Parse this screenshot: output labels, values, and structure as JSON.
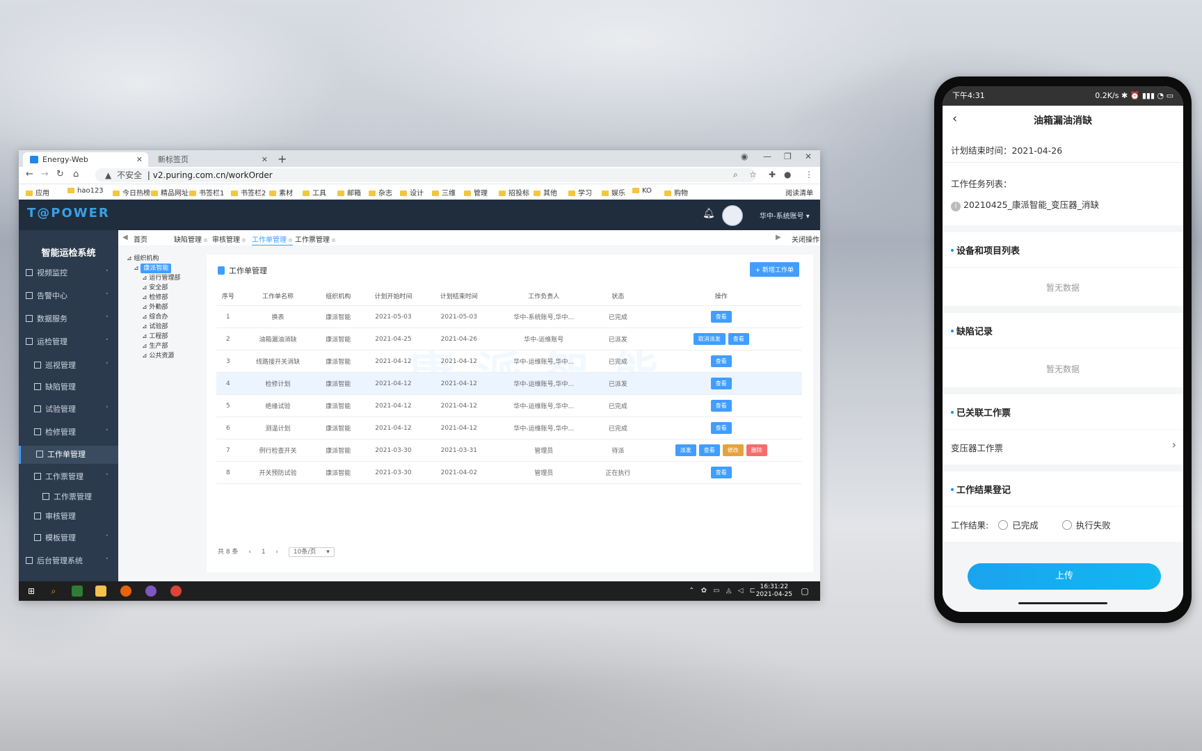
{
  "browser": {
    "active_tab": "Energy-Web",
    "inactive_tab": "新标签页",
    "new_tab": "+",
    "url_warning": "不安全",
    "url": "v2.puring.com.cn/workOrder",
    "bookmarks": [
      "应用",
      "hao123",
      "今日热榜",
      "精品网址",
      "书签栏1",
      "书签栏2",
      "素材",
      "工具",
      "邮箱",
      "杂志",
      "设计",
      "三维",
      "管理",
      "招投标",
      "其他",
      "学习",
      "娱乐",
      "KO",
      "购物"
    ],
    "reading_list": "阅读清单"
  },
  "app": {
    "logo": "T@POWER",
    "user_name": "华中-系统账号",
    "sidebar_title": "智能运检系统",
    "sidebar": [
      {
        "label": "视频监控",
        "chev": "˅"
      },
      {
        "label": "告警中心",
        "chev": "˅"
      },
      {
        "label": "数据服务",
        "chev": "˅"
      },
      {
        "label": "运检管理",
        "chev": "˄"
      },
      {
        "label": "巡视管理",
        "chev": "˅"
      },
      {
        "label": "缺陷管理",
        "chev": ""
      },
      {
        "label": "试验管理",
        "chev": "˅"
      },
      {
        "label": "检修管理",
        "chev": "˅"
      },
      {
        "label": "工作单管理",
        "chev": ""
      },
      {
        "label": "工作票管理",
        "chev": "˄"
      },
      {
        "label": "工作票管理",
        "chev": ""
      },
      {
        "label": "审核管理",
        "chev": ""
      },
      {
        "label": "模板管理",
        "chev": "˅"
      },
      {
        "label": "后台管理系统",
        "chev": "˅"
      }
    ],
    "tags": [
      "首页",
      "缺陷管理",
      "审核管理",
      "工作单管理",
      "工作票管理"
    ],
    "close_ops": "关闭操作",
    "tree": [
      "组织机构",
      "康派智能",
      "运行管理部",
      "安全部",
      "检修部",
      "外勤部",
      "综合办",
      "试验部",
      "工程部",
      "生产部",
      "公共资源"
    ],
    "panel_title": "工作单管理",
    "add_button": "+ 新增工作单",
    "watermark": "康 派 智 能",
    "table": {
      "headers": [
        "序号",
        "工作单名称",
        "组织机构",
        "计划开始时间",
        "计划结束时间",
        "工作负责人",
        "状态",
        "操作"
      ],
      "rows": [
        {
          "no": "1",
          "name": "换表",
          "org": "康派智能",
          "start": "2021-05-03",
          "end": "2021-05-03",
          "owner": "华中-系统账号,华中...",
          "status": "已完成",
          "actions": [
            "查看"
          ]
        },
        {
          "no": "2",
          "name": "油箱漏油消缺",
          "org": "康派智能",
          "start": "2021-04-25",
          "end": "2021-04-26",
          "owner": "华中-运维账号",
          "status": "已派发",
          "actions": [
            "取消派发",
            "查看"
          ]
        },
        {
          "no": "3",
          "name": "线路接开关消缺",
          "org": "康派智能",
          "start": "2021-04-12",
          "end": "2021-04-12",
          "owner": "华中-运维账号,华中...",
          "status": "已完成",
          "actions": [
            "查看"
          ]
        },
        {
          "no": "4",
          "name": "检修计划",
          "org": "康派智能",
          "start": "2021-04-12",
          "end": "2021-04-12",
          "owner": "华中-运维账号,华中...",
          "status": "已派发",
          "actions": [
            "查看"
          ]
        },
        {
          "no": "5",
          "name": "绝缘试验",
          "org": "康派智能",
          "start": "2021-04-12",
          "end": "2021-04-12",
          "owner": "华中-运维账号,华中...",
          "status": "已完成",
          "actions": [
            "查看"
          ]
        },
        {
          "no": "6",
          "name": "测温计划",
          "org": "康派智能",
          "start": "2021-04-12",
          "end": "2021-04-12",
          "owner": "华中-运维账号,华中...",
          "status": "已完成",
          "actions": [
            "查看"
          ]
        },
        {
          "no": "7",
          "name": "例行检查开关",
          "org": "康派智能",
          "start": "2021-03-30",
          "end": "2021-03-31",
          "owner": "管理员",
          "status": "待派",
          "actions": [
            "派发",
            "查看",
            "修改",
            "删除"
          ]
        },
        {
          "no": "8",
          "name": "开关预防试验",
          "org": "康派智能",
          "start": "2021-03-30",
          "end": "2021-04-02",
          "owner": "管理员",
          "status": "正在执行",
          "actions": [
            "查看"
          ]
        }
      ]
    },
    "pager": {
      "total": "共 8 条",
      "page": "1",
      "size": "10条/页"
    }
  },
  "taskbar": {
    "time": "16:31:22",
    "date": "2021-04-25"
  },
  "phone": {
    "status_time": "下午4:31",
    "status_right": "0.2K/s ✱ ⏰ ▮▮▮ ◔ ▭",
    "title": "油箱漏油消缺",
    "end_time_label": "计划结束时间：",
    "end_time": "2021-04-26",
    "task_list_label": "工作任务列表：",
    "task_item": "20210425_康派智能_变压器_消缺",
    "equip_header": "设备和项目列表",
    "equip_empty": "暂无数据",
    "defect_header": "缺陷记录",
    "defect_empty": "暂无数据",
    "ticket_header": "已关联工作票",
    "ticket_item": "变压器工作票",
    "result_header": "工作结果登记",
    "result_label": "工作结果:",
    "opt_done": "已完成",
    "opt_fail": "执行失败",
    "upload": "上传"
  },
  "colors": {
    "accent": "#409eff",
    "sidebar": "#2b3a4c",
    "header": "#1f2d3d",
    "upload": "#12b8f0"
  }
}
